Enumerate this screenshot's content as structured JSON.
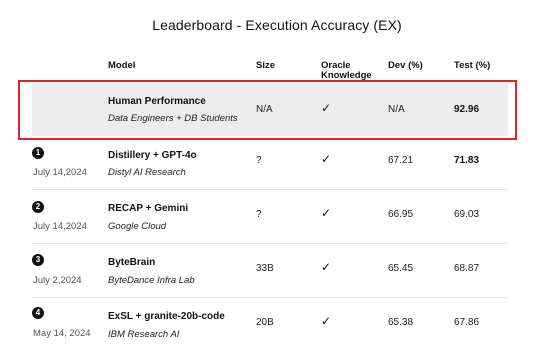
{
  "title": "Leaderboard - Execution Accuracy (EX)",
  "columns": {
    "model": "Model",
    "size": "Size",
    "oracle_line1": "Oracle",
    "oracle_line2": "Knowledge",
    "dev": "Dev (%)",
    "test": "Test (%)"
  },
  "human": {
    "name": "Human Performance",
    "org": "Data Engineers + DB Students",
    "size": "N/A",
    "oracle": "✓",
    "dev": "N/A",
    "test": "92.96"
  },
  "rows": [
    {
      "rank": "1",
      "date": "July 14,2024",
      "name": "Distillery + GPT-4o",
      "org": "Distyl AI Research",
      "size": "?",
      "oracle": "✓",
      "dev": "67.21",
      "test": "71.83"
    },
    {
      "rank": "2",
      "date": "July 14,2024",
      "name": "RECAP + Gemini",
      "org": "Google Cloud",
      "size": "?",
      "oracle": "✓",
      "dev": "66.95",
      "test": "69.03"
    },
    {
      "rank": "3",
      "date": "July 2,2024",
      "name": "ByteBrain",
      "org": "ByteDance Infra Lab",
      "size": "33B",
      "oracle": "✓",
      "dev": "65.45",
      "test": "68.87"
    },
    {
      "rank": "4",
      "date": "May 14, 2024",
      "name": "ExSL + granite-20b-code",
      "org": "IBM Research AI",
      "size": "20B",
      "oracle": "✓",
      "dev": "65.38",
      "test": "67.86"
    }
  ]
}
